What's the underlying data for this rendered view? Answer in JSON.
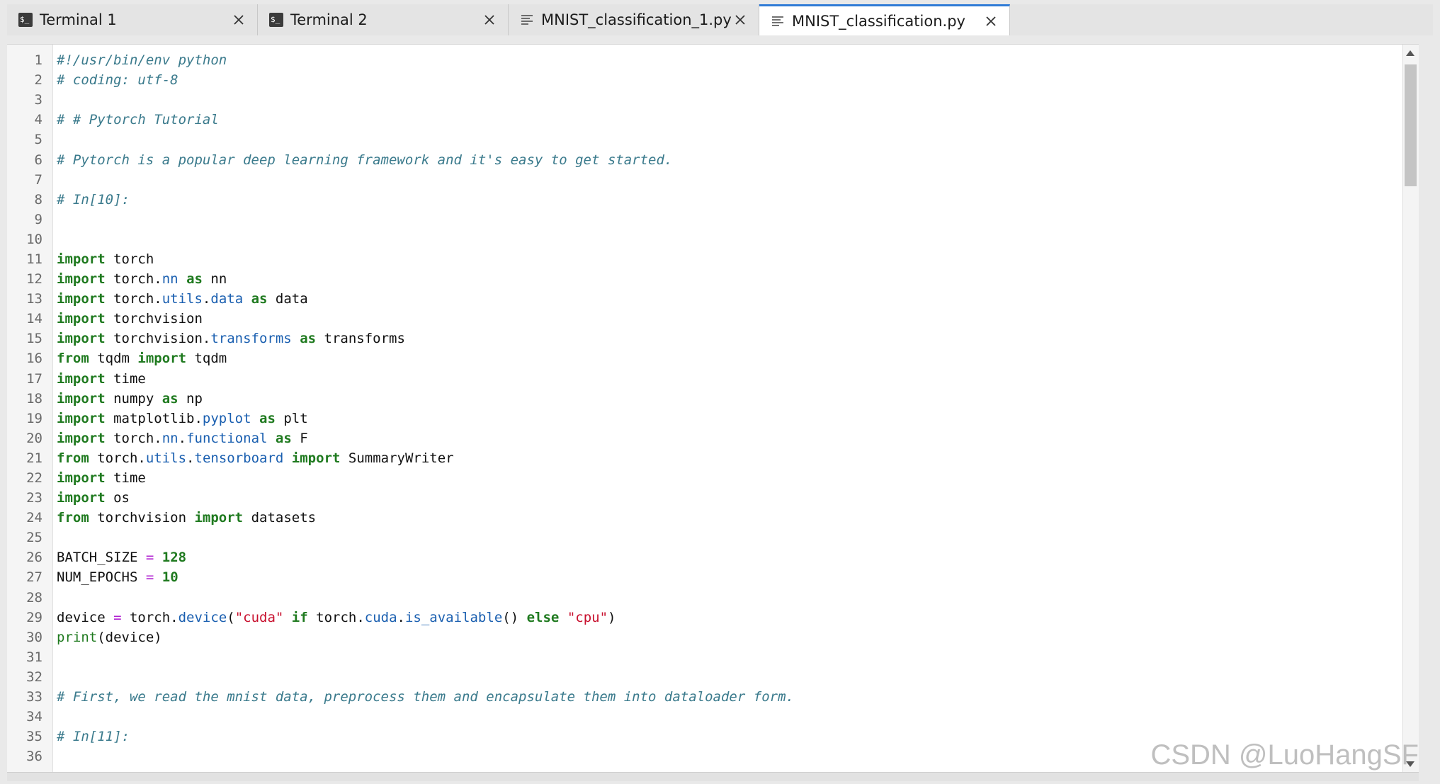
{
  "tabs": [
    {
      "label": "Terminal 1",
      "icon": "terminal-icon",
      "active": false
    },
    {
      "label": "Terminal 2",
      "icon": "terminal-icon",
      "active": false
    },
    {
      "label": "MNIST_classification_1.py",
      "icon": "file-lines-icon",
      "active": false
    },
    {
      "label": "MNIST_classification.py",
      "icon": "file-lines-icon",
      "active": true
    }
  ],
  "terminal_icon_text": "$_",
  "close_glyph": "✕",
  "watermark": "CSDN @LuoHangSF",
  "colors": {
    "comment": "#3a7a8c",
    "keyword": "#1f7a1f",
    "attribute": "#1a5fb0",
    "string": "#c8102e",
    "operator": "#b020d0",
    "active_tab_accent": "#2f7bd6"
  },
  "code_lines": [
    [
      [
        "cmt",
        "#!/usr/bin/env python"
      ]
    ],
    [
      [
        "cmt",
        "# coding: utf-8"
      ]
    ],
    [],
    [
      [
        "cmt",
        "# # Pytorch Tutorial"
      ]
    ],
    [],
    [
      [
        "cmt",
        "# Pytorch is a popular deep learning framework and it's easy to get started."
      ]
    ],
    [],
    [
      [
        "cmt",
        "# In[10]:"
      ]
    ],
    [],
    [],
    [
      [
        "kw",
        "import"
      ],
      [
        "",
        " torch"
      ]
    ],
    [
      [
        "kw",
        "import"
      ],
      [
        "",
        " torch."
      ],
      [
        "attr",
        "nn"
      ],
      [
        "",
        " "
      ],
      [
        "kw",
        "as"
      ],
      [
        "",
        " nn"
      ]
    ],
    [
      [
        "kw",
        "import"
      ],
      [
        "",
        " torch."
      ],
      [
        "attr",
        "utils"
      ],
      [
        "",
        "."
      ],
      [
        "attr",
        "data"
      ],
      [
        "",
        " "
      ],
      [
        "kw",
        "as"
      ],
      [
        "",
        " data"
      ]
    ],
    [
      [
        "kw",
        "import"
      ],
      [
        "",
        " torchvision"
      ]
    ],
    [
      [
        "kw",
        "import"
      ],
      [
        "",
        " torchvision."
      ],
      [
        "attr",
        "transforms"
      ],
      [
        "",
        " "
      ],
      [
        "kw",
        "as"
      ],
      [
        "",
        " transforms"
      ]
    ],
    [
      [
        "kw",
        "from"
      ],
      [
        "",
        " tqdm "
      ],
      [
        "kw",
        "import"
      ],
      [
        "",
        " tqdm"
      ]
    ],
    [
      [
        "kw",
        "import"
      ],
      [
        "",
        " time"
      ]
    ],
    [
      [
        "kw",
        "import"
      ],
      [
        "",
        " numpy "
      ],
      [
        "kw",
        "as"
      ],
      [
        "",
        " np"
      ]
    ],
    [
      [
        "kw",
        "import"
      ],
      [
        "",
        " matplotlib."
      ],
      [
        "attr",
        "pyplot"
      ],
      [
        "",
        " "
      ],
      [
        "kw",
        "as"
      ],
      [
        "",
        " plt"
      ]
    ],
    [
      [
        "kw",
        "import"
      ],
      [
        "",
        " torch."
      ],
      [
        "attr",
        "nn"
      ],
      [
        "",
        "."
      ],
      [
        "attr",
        "functional"
      ],
      [
        "",
        " "
      ],
      [
        "kw",
        "as"
      ],
      [
        "",
        " F"
      ]
    ],
    [
      [
        "kw",
        "from"
      ],
      [
        "",
        " torch."
      ],
      [
        "attr",
        "utils"
      ],
      [
        "",
        "."
      ],
      [
        "attr",
        "tensorboard"
      ],
      [
        "",
        " "
      ],
      [
        "kw",
        "import"
      ],
      [
        "",
        " SummaryWriter"
      ]
    ],
    [
      [
        "kw",
        "import"
      ],
      [
        "",
        " time"
      ]
    ],
    [
      [
        "kw",
        "import"
      ],
      [
        "",
        " os"
      ]
    ],
    [
      [
        "kw",
        "from"
      ],
      [
        "",
        " torchvision "
      ],
      [
        "kw",
        "import"
      ],
      [
        "",
        " datasets"
      ]
    ],
    [],
    [
      [
        "",
        "BATCH_SIZE "
      ],
      [
        "op",
        "="
      ],
      [
        "",
        " "
      ],
      [
        "num",
        "128"
      ]
    ],
    [
      [
        "",
        "NUM_EPOCHS "
      ],
      [
        "op",
        "="
      ],
      [
        "",
        " "
      ],
      [
        "num",
        "10"
      ]
    ],
    [],
    [
      [
        "",
        "device "
      ],
      [
        "op",
        "="
      ],
      [
        "",
        " torch."
      ],
      [
        "attr",
        "device"
      ],
      [
        "",
        "("
      ],
      [
        "str",
        "\"cuda\""
      ],
      [
        "",
        " "
      ],
      [
        "kw",
        "if"
      ],
      [
        "",
        " torch."
      ],
      [
        "attr",
        "cuda"
      ],
      [
        "",
        "."
      ],
      [
        "attr",
        "is_available"
      ],
      [
        "",
        "() "
      ],
      [
        "kw",
        "else"
      ],
      [
        "",
        " "
      ],
      [
        "str",
        "\"cpu\""
      ],
      [
        "",
        ")"
      ]
    ],
    [
      [
        "fn",
        "print"
      ],
      [
        "",
        "(device)"
      ]
    ],
    [],
    [],
    [
      [
        "cmt",
        "# First, we read the mnist data, preprocess them and encapsulate them into dataloader form."
      ]
    ],
    [],
    [
      [
        "cmt",
        "# In[11]:"
      ]
    ],
    []
  ]
}
